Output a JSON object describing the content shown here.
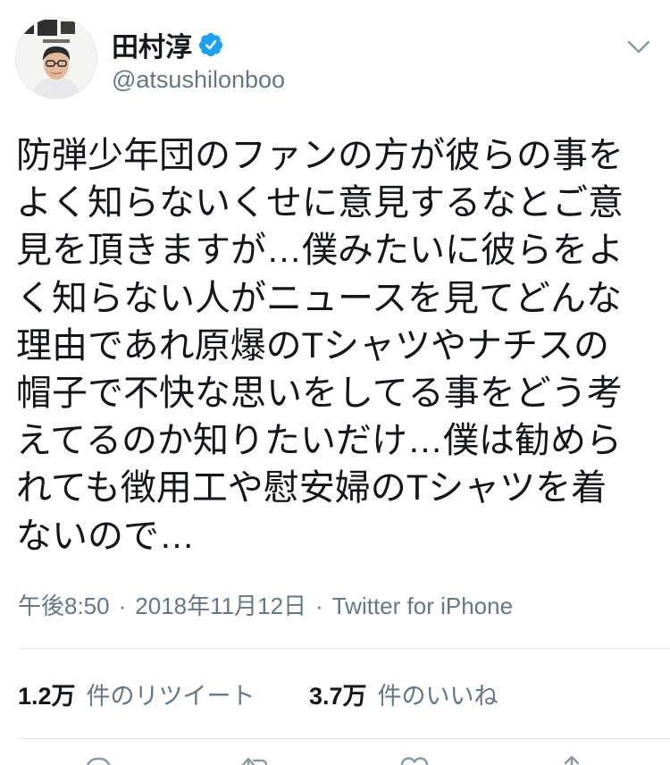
{
  "colors": {
    "text": "#14171a",
    "secondary": "#657786",
    "divider": "#e1e8ed",
    "verified": "#1da1f2"
  },
  "tweet": {
    "author": {
      "name": "田村淳",
      "handle": "@atsushilonboo",
      "verified": true,
      "avatar_icon": "profile-photo"
    },
    "menu_icon": "chevron-down-icon",
    "text_lines": [
      "防弾少年団のファンの方が彼らの事を",
      "よく知らないくせに意見するなとご意",
      "見を頂きますが…僕みたいに彼らをよ",
      "く知らない人がニュースを見てどんな",
      "理由であれ原爆のTシャツやナチスの",
      "帽子で不快な思いをしてる事をどう考",
      "えてるのか知りたいだけ…僕は勧めら",
      "れても徴用工や慰安婦のTシャツを着",
      "ないので…"
    ],
    "meta": {
      "time": "午後8:50",
      "separator": "·",
      "date": "2018年11月12日",
      "source": "Twitter for iPhone"
    },
    "stats": {
      "retweets": {
        "count": "1.2万",
        "label": "件のリツイート"
      },
      "likes": {
        "count": "3.7万",
        "label": "件のいいね"
      }
    },
    "actions": [
      "reply-icon",
      "retweet-icon",
      "like-icon",
      "share-icon"
    ]
  }
}
